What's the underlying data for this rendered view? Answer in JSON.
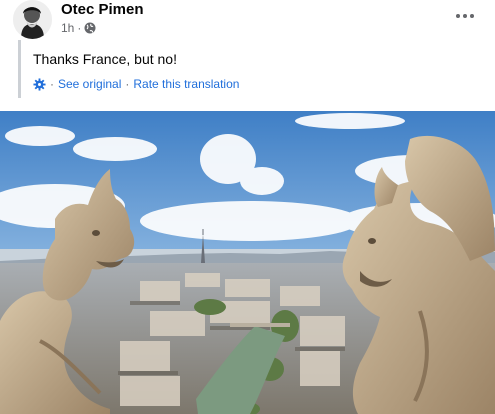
{
  "post": {
    "author": "Otec Pimen",
    "time": "1h",
    "audience_icon": "globe-icon",
    "more_icon": "more-horizontal-icon",
    "text": "Thanks France, but no!",
    "translation": {
      "icon": "gear-icon",
      "see_original": "See original",
      "separator": "·",
      "rate": "Rate this translation"
    }
  },
  "photo": {
    "subject": "gargoyles overlooking paris",
    "colors": {
      "sky_top": "#3f7fc6",
      "sky_bottom": "#c7ddf0",
      "stone": "#c8b497",
      "river": "#7c9a80"
    }
  },
  "colors": {
    "link": "#216fdb",
    "secondary_text": "#65676b",
    "quote_bar": "#ccd0d5"
  }
}
